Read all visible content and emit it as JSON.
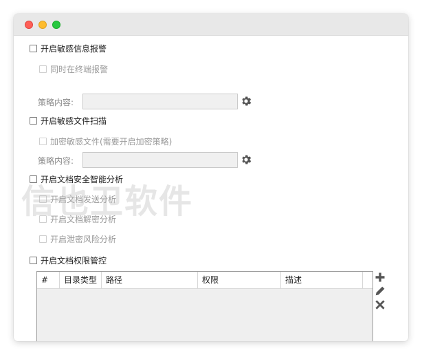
{
  "sensitive_alert": {
    "label": "开启敏感信息报警",
    "terminal_alert_label": "同时在终端报警",
    "strategy_label": "策略内容:",
    "strategy_value": ""
  },
  "sensitive_scan": {
    "label": "开启敏感文件扫描",
    "encrypt_label": "加密敏感文件(需要开启加密策略)",
    "strategy_label": "策略内容:",
    "strategy_value": ""
  },
  "smart_analysis": {
    "label": "开启文档安全智能分析",
    "options": [
      "开启文档发送分析",
      "开启文档解密分析",
      "开启泄密风险分析"
    ]
  },
  "permission_control": {
    "label": "开启文档权限管控",
    "columns": [
      "#",
      "目录类型",
      "路径",
      "权限",
      "描述"
    ]
  },
  "watermark": "信也卫软件",
  "icons": {
    "gear": "gear-icon",
    "add": "plus-icon",
    "edit": "pencil-icon",
    "delete": "close-icon"
  },
  "colors": {
    "title_bar": "#e8e8e8",
    "icon": "#555555",
    "input_bg": "#f0f0f0"
  }
}
